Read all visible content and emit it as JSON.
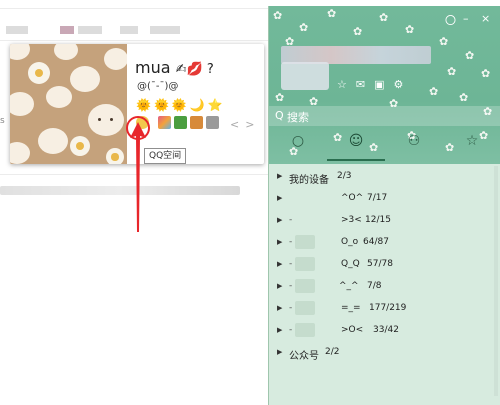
{
  "profile_card": {
    "nickname": "mua",
    "nickname_emoji": "✍💋 ?",
    "signature": "@(¯-¯)@",
    "level_icons": [
      "🌞",
      "🌞",
      "🌞",
      "🌙",
      "⭐"
    ],
    "tooltip": "QQ空间",
    "app_icons": [
      {
        "name": "qzone-icon",
        "color": "#f2c94c"
      },
      {
        "name": "photo-icon",
        "color": "#e45a84"
      },
      {
        "name": "game-icon",
        "color": "#4b9e3f"
      },
      {
        "name": "pet-icon",
        "color": "#d78a3a"
      },
      {
        "name": "gem-icon",
        "color": "#8c8c8c"
      }
    ],
    "arrow_prev": "<",
    "arrow_next": ">"
  },
  "panel": {
    "window_controls": [
      "〇",
      "–",
      "×"
    ],
    "header_icons": [
      "☆",
      "✉",
      "▣",
      "⚙"
    ],
    "search_placeholder": "搜索",
    "tabs": [
      {
        "name": "tab-messages",
        "icon": "○"
      },
      {
        "name": "tab-contacts",
        "icon": "☺"
      },
      {
        "name": "tab-groups",
        "icon": "⚇"
      },
      {
        "name": "tab-favorites",
        "icon": "☆"
      }
    ],
    "accent_color": "#6db596",
    "groups": [
      {
        "label": "我的设备",
        "count": "2/3"
      },
      {
        "label": "^O^",
        "count": "7/17"
      },
      {
        "label": ">3<",
        "count": "12/15"
      },
      {
        "label": "O_o",
        "count": "64/87"
      },
      {
        "label": "Q_Q",
        "count": "57/78"
      },
      {
        "label": "^_^",
        "count": "7/8"
      },
      {
        "label": "=_=",
        "count": "177/219"
      },
      {
        "label": ">O<",
        "count": "33/42"
      },
      {
        "label": "公众号",
        "count": "2/2"
      }
    ]
  }
}
